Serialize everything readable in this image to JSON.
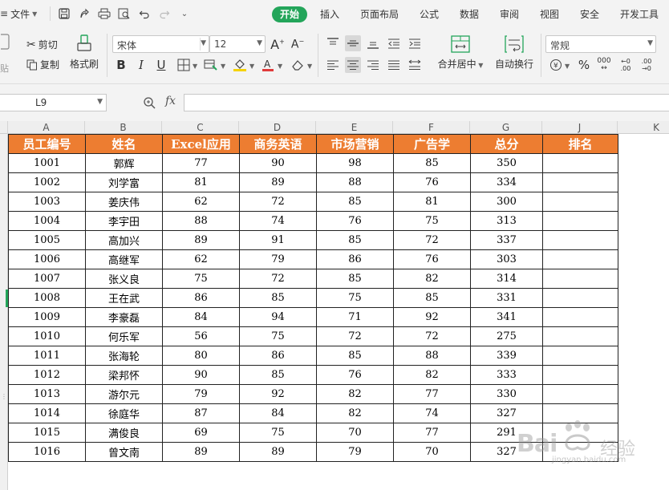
{
  "menubar": {
    "file_label": "文件",
    "tabs": [
      {
        "label": "开始",
        "active": true
      },
      {
        "label": "插入",
        "active": false
      },
      {
        "label": "页面布局",
        "active": false
      },
      {
        "label": "公式",
        "active": false
      },
      {
        "label": "数据",
        "active": false
      },
      {
        "label": "审阅",
        "active": false
      },
      {
        "label": "视图",
        "active": false
      },
      {
        "label": "安全",
        "active": false
      },
      {
        "label": "开发工具",
        "active": false
      }
    ]
  },
  "ribbon": {
    "cut_label": "剪切",
    "copy_label": "复制",
    "paste_label": "贴",
    "format_painter_label": "格式刷",
    "font_name": "宋体",
    "font_size": "12",
    "merge_label": "合并居中",
    "wrap_label": "自动换行",
    "number_format": "常规",
    "font_color": "#e03b3b",
    "fill_color": "#f5d300"
  },
  "formula_bar": {
    "cell_ref": "L9",
    "fx_label": "fx",
    "formula": ""
  },
  "sheet": {
    "columns": [
      "A",
      "B",
      "C",
      "D",
      "E",
      "F",
      "G",
      "J",
      "K"
    ],
    "headers": [
      "员工编号",
      "姓名",
      "Excel应用",
      "商务英语",
      "市场营销",
      "广告学",
      "总分",
      "排名"
    ],
    "rows": [
      [
        "1001",
        "郭辉",
        "77",
        "90",
        "98",
        "85",
        "350",
        ""
      ],
      [
        "1002",
        "刘学富",
        "81",
        "89",
        "88",
        "76",
        "334",
        ""
      ],
      [
        "1003",
        "姜庆伟",
        "62",
        "72",
        "85",
        "81",
        "300",
        ""
      ],
      [
        "1004",
        "李宇田",
        "88",
        "74",
        "76",
        "75",
        "313",
        ""
      ],
      [
        "1005",
        "高加兴",
        "89",
        "91",
        "85",
        "72",
        "337",
        ""
      ],
      [
        "1006",
        "高继军",
        "62",
        "79",
        "86",
        "76",
        "303",
        ""
      ],
      [
        "1007",
        "张义良",
        "75",
        "72",
        "85",
        "82",
        "314",
        ""
      ],
      [
        "1008",
        "王在武",
        "86",
        "85",
        "75",
        "85",
        "331",
        ""
      ],
      [
        "1009",
        "李豪磊",
        "84",
        "94",
        "71",
        "92",
        "341",
        ""
      ],
      [
        "1010",
        "何乐军",
        "56",
        "75",
        "72",
        "72",
        "275",
        ""
      ],
      [
        "1011",
        "张海轮",
        "80",
        "86",
        "85",
        "88",
        "339",
        ""
      ],
      [
        "1012",
        "梁邦怀",
        "90",
        "85",
        "76",
        "82",
        "333",
        ""
      ],
      [
        "1013",
        "游尔元",
        "79",
        "92",
        "82",
        "77",
        "330",
        ""
      ],
      [
        "1014",
        "徐庭华",
        "87",
        "84",
        "82",
        "74",
        "327",
        ""
      ],
      [
        "1015",
        "满俊良",
        "69",
        "75",
        "70",
        "77",
        "291",
        ""
      ],
      [
        "1016",
        "曾文南",
        "89",
        "89",
        "79",
        "70",
        "327",
        ""
      ]
    ],
    "header_color": "#ed7d31"
  },
  "watermark": {
    "logo_text": "Bai",
    "logo_suffix": "经验",
    "url": "jingyan.baidu.com"
  },
  "colors": {
    "accent": "#23a55a"
  }
}
